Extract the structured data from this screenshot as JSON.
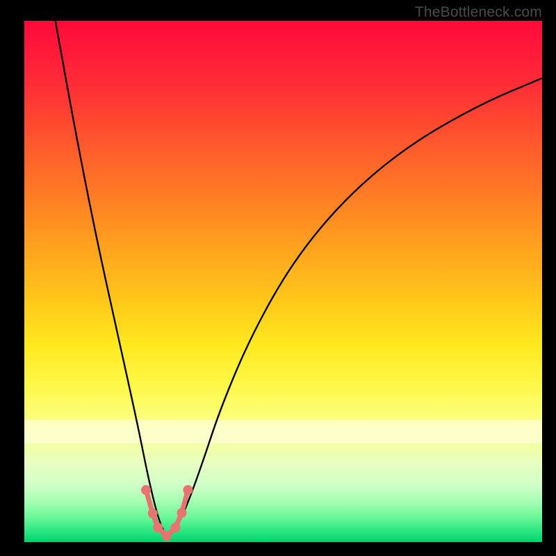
{
  "watermark": "TheBottleneck.com",
  "chart_data": {
    "type": "line",
    "title": "",
    "xlabel": "",
    "ylabel": "",
    "xlim": [
      0,
      100
    ],
    "ylim": [
      0,
      100
    ],
    "grid": false,
    "legend": false,
    "background_gradient": {
      "orientation": "vertical",
      "stops": [
        {
          "pos": 0,
          "color": "#ff0a3a"
        },
        {
          "pos": 14,
          "color": "#ff3335"
        },
        {
          "pos": 34,
          "color": "#ff7e24"
        },
        {
          "pos": 54,
          "color": "#ffc91a"
        },
        {
          "pos": 70,
          "color": "#fff84a"
        },
        {
          "pos": 85,
          "color": "#e7ffc0"
        },
        {
          "pos": 100,
          "color": "#00d26a"
        }
      ]
    },
    "series": [
      {
        "name": "bottleneck-curve",
        "color": "#000000",
        "x": [
          6,
          10,
          14,
          18,
          22,
          24,
          26,
          27.5,
          29,
          31,
          34,
          38,
          44,
          52,
          62,
          74,
          88,
          100
        ],
        "y": [
          100,
          78,
          58,
          40,
          22,
          12,
          4,
          1,
          2,
          6,
          14,
          26,
          40,
          54,
          66,
          76,
          84,
          89
        ]
      }
    ],
    "markers": [
      {
        "x": 23.5,
        "y": 10.0,
        "color": "#e9736e"
      },
      {
        "x": 24.8,
        "y": 5.5,
        "color": "#e9736e"
      },
      {
        "x": 25.8,
        "y": 2.8,
        "color": "#e9736e"
      },
      {
        "x": 27.5,
        "y": 1.2,
        "color": "#e9736e"
      },
      {
        "x": 29.2,
        "y": 2.8,
        "color": "#e9736e"
      },
      {
        "x": 30.4,
        "y": 5.6,
        "color": "#e9736e"
      },
      {
        "x": 31.6,
        "y": 10.0,
        "color": "#e9736e"
      }
    ],
    "bottom_segment": {
      "color": "#e9736e",
      "x": [
        23.5,
        24.8,
        25.8,
        27.5,
        29.2,
        30.4,
        31.6
      ],
      "y": [
        10.0,
        5.5,
        2.8,
        1.2,
        2.8,
        5.6,
        10.0
      ]
    }
  }
}
